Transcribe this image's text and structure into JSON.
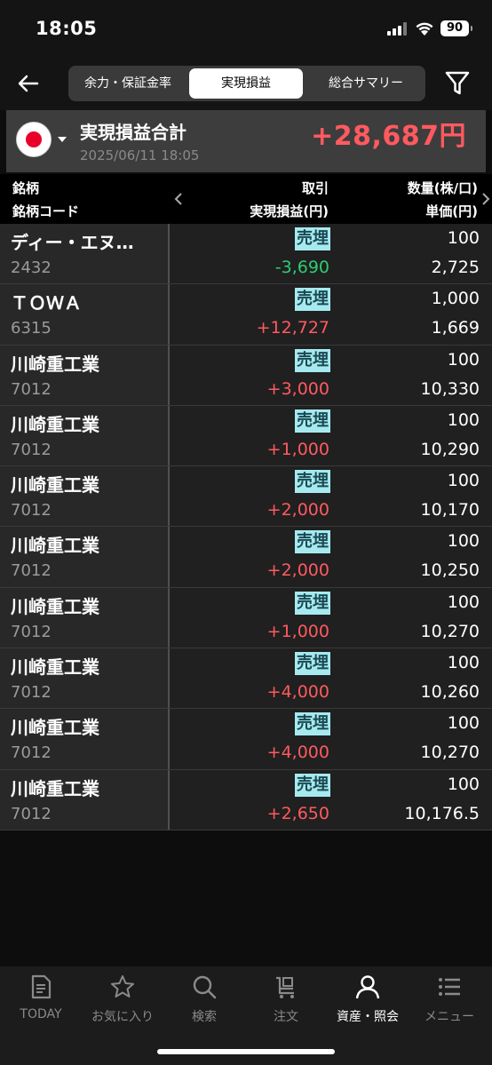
{
  "status_bar": {
    "time": "18:05",
    "battery": "90"
  },
  "header": {
    "tabs": [
      "余力・保証金率",
      "実現損益",
      "総合サマリー"
    ],
    "active_tab": "実現損益"
  },
  "summary": {
    "label": "実現損益合計",
    "value": "+28,687円",
    "datetime": "2025/06/11 18:05"
  },
  "columns": {
    "name": "銘柄",
    "code": "銘柄コード",
    "trade": "取引",
    "pnl": "実現損益(円)",
    "qty": "数量(株/口)",
    "price": "単価(円)"
  },
  "rows": [
    {
      "name": "ディー・エヌ…",
      "code": "2432",
      "trade": "売埋",
      "pnl": "-3,690",
      "qty": "100",
      "price": "2,725"
    },
    {
      "name": "ＴＯＷＡ",
      "code": "6315",
      "trade": "売埋",
      "pnl": "+12,727",
      "qty": "1,000",
      "price": "1,669"
    },
    {
      "name": "川崎重工業",
      "code": "7012",
      "trade": "売埋",
      "pnl": "+3,000",
      "qty": "100",
      "price": "10,330"
    },
    {
      "name": "川崎重工業",
      "code": "7012",
      "trade": "売埋",
      "pnl": "+1,000",
      "qty": "100",
      "price": "10,290"
    },
    {
      "name": "川崎重工業",
      "code": "7012",
      "trade": "売埋",
      "pnl": "+2,000",
      "qty": "100",
      "price": "10,170"
    },
    {
      "name": "川崎重工業",
      "code": "7012",
      "trade": "売埋",
      "pnl": "+2,000",
      "qty": "100",
      "price": "10,250"
    },
    {
      "name": "川崎重工業",
      "code": "7012",
      "trade": "売埋",
      "pnl": "+1,000",
      "qty": "100",
      "price": "10,270"
    },
    {
      "name": "川崎重工業",
      "code": "7012",
      "trade": "売埋",
      "pnl": "+4,000",
      "qty": "100",
      "price": "10,260"
    },
    {
      "name": "川崎重工業",
      "code": "7012",
      "trade": "売埋",
      "pnl": "+4,000",
      "qty": "100",
      "price": "10,270"
    },
    {
      "name": "川崎重工業",
      "code": "7012",
      "trade": "売埋",
      "pnl": "+2,650",
      "qty": "100",
      "price": "10,176.5"
    }
  ],
  "bottom_nav": [
    {
      "label": "TODAY",
      "icon": "document-icon"
    },
    {
      "label": "お気に入り",
      "icon": "star-icon"
    },
    {
      "label": "検索",
      "icon": "search-icon"
    },
    {
      "label": "注文",
      "icon": "cart-icon"
    },
    {
      "label": "資産・照会",
      "icon": "person-icon",
      "active": true
    },
    {
      "label": "メニュー",
      "icon": "menu-icon"
    }
  ],
  "colors": {
    "positive": "#ff5a5f",
    "negative": "#2ecc71",
    "trade_badge": "#a6eaf0"
  }
}
